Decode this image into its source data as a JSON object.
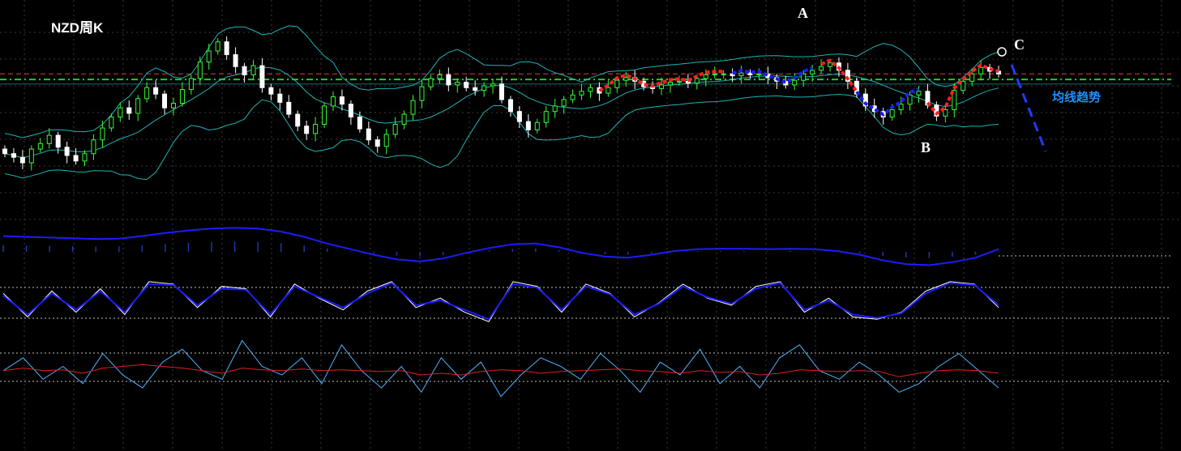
{
  "header": {
    "title": "NZD周K"
  },
  "annotations": {
    "label_a": "A",
    "label_b": "B",
    "label_c": "C",
    "trend_text": "均线趋势"
  },
  "colors": {
    "bull": "#32ff32",
    "bear": "#ffffff",
    "boll": "#1fb3b3",
    "grid": "#3a3a3a",
    "ma_up": "#ff2020",
    "ma_down": "#1c1cff",
    "macd": "#1c1cff",
    "kdj_k": "#ffffff",
    "kdj_d": "#1c1cff",
    "rsi_fast": "#4ab4ff",
    "rsi_slow": "#e02020"
  },
  "chart_data": [
    {
      "type": "candlestick",
      "title": "NZD周K",
      "note": "weekly candles, approximate close series (price-panel units)",
      "close": [
        0.64,
        0.636,
        0.63,
        0.645,
        0.651,
        0.66,
        0.647,
        0.638,
        0.632,
        0.64,
        0.655,
        0.668,
        0.68,
        0.69,
        0.684,
        0.7,
        0.712,
        0.705,
        0.69,
        0.695,
        0.71,
        0.722,
        0.74,
        0.752,
        0.762,
        0.748,
        0.735,
        0.726,
        0.736,
        0.712,
        0.705,
        0.696,
        0.683,
        0.67,
        0.662,
        0.672,
        0.692,
        0.702,
        0.694,
        0.68,
        0.667,
        0.655,
        0.648,
        0.661,
        0.672,
        0.683,
        0.698,
        0.713,
        0.722,
        0.726,
        0.715,
        0.718,
        0.712,
        0.709,
        0.714,
        0.716,
        0.699,
        0.686,
        0.675,
        0.666,
        0.674,
        0.686,
        0.692,
        0.699,
        0.704,
        0.708,
        0.712,
        0.706,
        0.712,
        0.72,
        0.723,
        0.719,
        0.713,
        0.711,
        0.715,
        0.718,
        0.719,
        0.717,
        0.722,
        0.726,
        0.727,
        0.727,
        0.725,
        0.728,
        0.726,
        0.727,
        0.723,
        0.719,
        0.715,
        0.72,
        0.727,
        0.731,
        0.735,
        0.739,
        0.731,
        0.719,
        0.705,
        0.692,
        0.686,
        0.68,
        0.688,
        0.694,
        0.704,
        0.708,
        0.693,
        0.681,
        0.688,
        0.709,
        0.719,
        0.727,
        0.734,
        0.73,
        0.727
      ],
      "reference_levels": {
        "upper_dashed": 0.727,
        "lower_dashed": 0.721,
        "horizontal": 0.716
      },
      "markers": [
        "A",
        "B",
        "C"
      ]
    },
    {
      "type": "line",
      "title": "",
      "series": [
        {
          "values": [
            0.4,
            0.38,
            0.36,
            0.34,
            0.32,
            0.33,
            0.4,
            0.48,
            0.55,
            0.6,
            0.62,
            0.6,
            0.52,
            0.38,
            0.2,
            0.05,
            -0.1,
            -0.22,
            -0.28,
            -0.2,
            -0.05,
            0.08,
            0.18,
            0.2,
            0.1,
            -0.05,
            -0.15,
            -0.18,
            -0.1,
            0.0,
            0.05,
            0.06,
            0.06,
            0.05,
            0.06,
            0.05,
            0.0,
            -0.1,
            -0.25,
            -0.35,
            -0.38,
            -0.3,
            -0.18,
            0.05
          ]
        }
      ]
    },
    {
      "type": "line",
      "title": "",
      "series": [
        {
          "values": [
            70,
            20,
            75,
            30,
            80,
            25,
            95,
            90,
            40,
            85,
            80,
            20,
            90,
            60,
            35,
            75,
            95,
            40,
            60,
            30,
            10,
            95,
            85,
            30,
            90,
            70,
            20,
            50,
            90,
            60,
            45,
            85,
            95,
            30,
            60,
            20,
            15,
            30,
            75,
            95,
            90,
            40
          ]
        },
        {
          "values": [
            65,
            25,
            70,
            35,
            75,
            30,
            90,
            88,
            45,
            80,
            78,
            25,
            85,
            62,
            40,
            70,
            92,
            45,
            55,
            35,
            15,
            90,
            82,
            35,
            85,
            68,
            25,
            48,
            85,
            62,
            48,
            80,
            92,
            35,
            55,
            25,
            18,
            28,
            70,
            92,
            88,
            45
          ]
        }
      ]
    },
    {
      "type": "line",
      "title": "",
      "series": [
        {
          "values": [
            55,
            70,
            45,
            60,
            40,
            75,
            50,
            35,
            65,
            80,
            55,
            45,
            90,
            60,
            50,
            70,
            40,
            85,
            55,
            35,
            60,
            30,
            70,
            45,
            65,
            25,
            50,
            70,
            60,
            45,
            75,
            55,
            30,
            65,
            50,
            80,
            40,
            60,
            35,
            70,
            85,
            55,
            45,
            65,
            50,
            30,
            40,
            60,
            75,
            55,
            35
          ]
        },
        {
          "values": [
            55,
            58,
            55,
            56,
            52,
            58,
            60,
            62,
            60,
            58,
            55,
            52,
            58,
            56,
            55,
            57,
            55,
            56,
            55,
            54,
            55,
            50,
            52,
            50,
            54,
            56,
            55,
            52,
            54,
            55,
            56,
            57,
            55,
            54,
            52,
            55,
            53,
            54,
            50,
            52,
            56,
            55,
            54,
            55,
            54,
            48,
            52,
            55,
            56,
            55,
            52
          ]
        }
      ]
    }
  ]
}
